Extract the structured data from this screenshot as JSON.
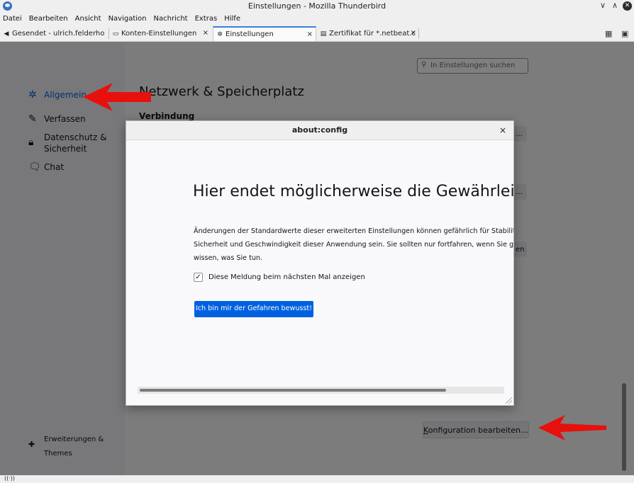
{
  "window": {
    "title": "Einstellungen - Mozilla Thunderbird"
  },
  "menubar": {
    "items": [
      "Datei",
      "Bearbeiten",
      "Ansicht",
      "Navigation",
      "Nachricht",
      "Extras",
      "Hilfe"
    ]
  },
  "tabs": [
    {
      "label": "Gesendet - ulrich.felderho",
      "icon": "send-icon"
    },
    {
      "label": "Konten-Einstellungen",
      "icon": "account-icon",
      "close": "×"
    },
    {
      "label": "Einstellungen",
      "icon": "gear-icon",
      "close": "×",
      "active": true
    },
    {
      "label": "Zertifikat für *.netbeat.c",
      "icon": "certificate-icon",
      "close": "×"
    }
  ],
  "sidebar": {
    "items": [
      {
        "label": "Allgemein",
        "icon": "gear-icon",
        "selected": true
      },
      {
        "label": "Verfassen",
        "icon": "pencil-icon"
      },
      {
        "label": "Datenschutz &",
        "label2": "Sicherheit",
        "icon": "lock-icon"
      },
      {
        "label": "Chat",
        "icon": "chat-icon"
      }
    ],
    "addons": {
      "label": "Erweiterungen &",
      "label2": "Themes",
      "icon": "puzzle-icon"
    }
  },
  "main": {
    "search_placeholder": "In Einstellungen suchen",
    "section_title": "Netzwerk & Speicherplatz",
    "subsection": "Verbindung",
    "stub_btn_1": "…",
    "stub_btn_2": "…",
    "stub_btn_3": "en",
    "config_button_hotkey": "K",
    "config_button_rest": "onfiguration bearbeiten…"
  },
  "dialog": {
    "title": "about:config",
    "close": "×",
    "heading": "Hier endet möglicherweise die Gewährleistung!",
    "text_line1": "Änderungen der Standardwerte dieser erweiterten Einstellungen können gefährlich für Stabilität",
    "text_line2": "Sicherheit und Geschwindigkeit dieser Anwendung sein. Sie sollten nur fortfahren, wenn Sie ge",
    "text_line3": "wissen, was Sie tun.",
    "checkbox_label": "Diese Meldung beim nächsten Mal anzeigen",
    "checkbox_checked": true,
    "accept_button": "Ich bin mir der Gefahren bewusst!"
  },
  "colors": {
    "accent": "#0060df",
    "annotation_arrow": "#e8100c"
  }
}
